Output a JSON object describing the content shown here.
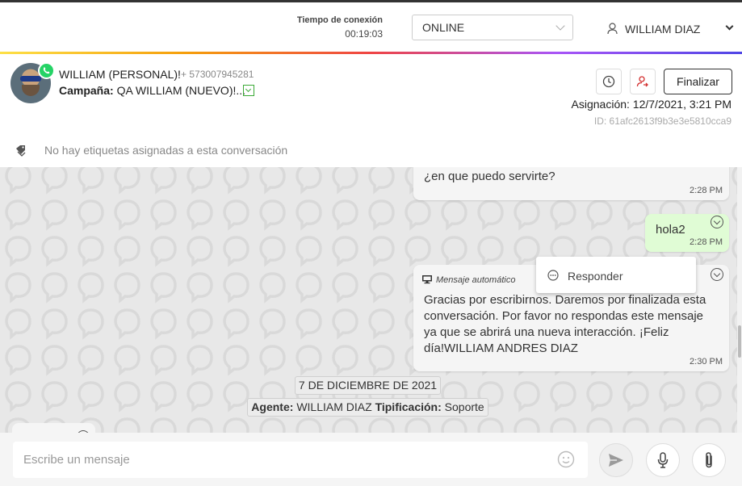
{
  "topbar": {
    "connection_label": "Tiempo de conexión",
    "connection_time": "00:19:03",
    "status_value": "ONLINE",
    "user_name": "WILLIAM DIAZ"
  },
  "contact": {
    "name": "WILLIAM (PERSONAL)!",
    "phone": "+ 573007945281",
    "campaign_label": "Campaña:",
    "campaign_value": "QA WILLIAM (NUEVO)!..."
  },
  "actions": {
    "finalize_label": "Finalizar",
    "assignment": "Asignación: 12/7/2021, 3:21 PM",
    "conversation_id": "ID: 61afc2613f9b3e3e5810cca9"
  },
  "tags": {
    "empty_text": "No hay etiquetas asignadas a esta conversación"
  },
  "messages": [
    {
      "text": "¿en que puedo servirte?",
      "time": "2:28 PM",
      "direction": "in"
    },
    {
      "text": "hola2",
      "time": "2:28 PM",
      "direction": "out"
    },
    {
      "label": "Mensaje automático",
      "text": "Gracias por escribirnos. Daremos por finalizada esta conversación. Por favor no respondas este mensaje ya que se abrirá una nueva interacción. ¡Feliz día!WILLIAM ANDRES DIAZ",
      "time": "2:30 PM",
      "direction": "in"
    }
  ],
  "context_menu": {
    "reply_label": "Responder"
  },
  "date_separator": "7 DE DICIEMBRE DE 2021",
  "agent_info": {
    "agent_label": "Agente:",
    "agent_name": "WILLIAM DIAZ",
    "typing_label": "Tipificación:",
    "typing_value": "Soporte"
  },
  "composer": {
    "placeholder": "Escribe un mensaje"
  },
  "colors": {
    "outgoing_bubble": "#e0fcd5",
    "incoming_bubble": "#f5f5f5",
    "whatsapp": "#25d366",
    "transfer_icon": "#d32f2f",
    "campaign_toggle": "#3aa935"
  },
  "icons": {
    "user": "user-icon",
    "whatsapp": "whatsapp-icon",
    "history": "clock-icon",
    "transfer": "user-transfer-icon",
    "tags": "tags-icon",
    "reply": "reply-icon",
    "auto_message": "monitor-icon",
    "emoji": "emoji-icon",
    "send": "send-icon",
    "mic": "microphone-icon",
    "attach": "paperclip-icon"
  }
}
